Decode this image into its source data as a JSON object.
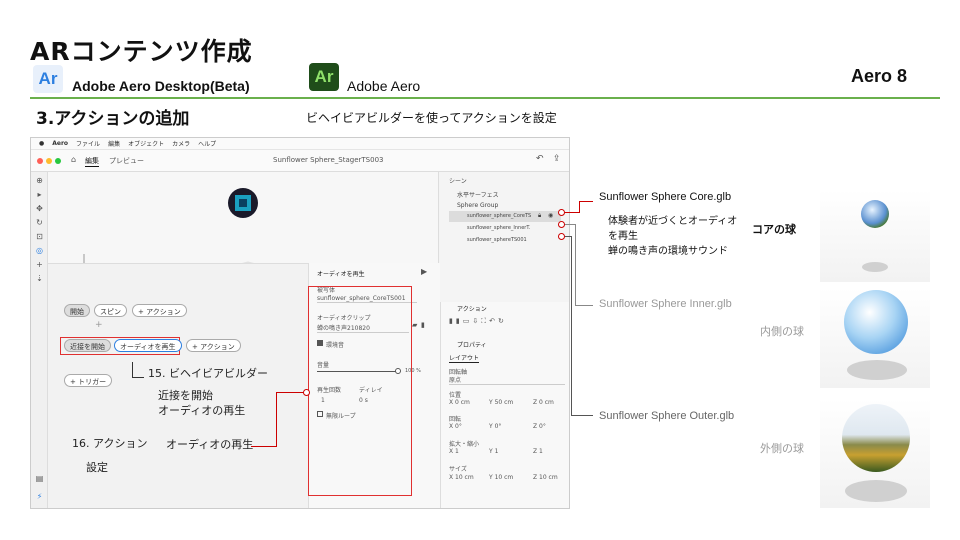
{
  "header": {
    "title": "ARコンテンツ作成",
    "brand1_logo": "Ar",
    "brand1_name": "Adobe Aero Desktop(Beta)",
    "brand2_logo": "Ar",
    "brand2_name": "Adobe Aero",
    "page_label": "Aero 8",
    "section": "3.アクションの追加",
    "section_desc": "ビヘイビアビルダーを使ってアクションを設定",
    "brand1_color": "#2d7fe0",
    "brand2_color": "#1f4d1a",
    "accent_line": "#6ab04c"
  },
  "app": {
    "menu": [
      "",
      "Aero",
      "ファイル",
      "編集",
      "オブジェクト",
      "カメラ",
      "ヘルプ"
    ],
    "tabs": {
      "edit": "編集",
      "preview": "プレビュー"
    },
    "doc_title": "Sunflower Sphere_StagerTS003",
    "scene": {
      "header": "シーン",
      "items": [
        "水平サーフェス",
        "Sphere Group",
        "sunflower_sphere_CoreTS",
        "sunflower_sphere_InnerT.",
        "sunflower_sphereTS001"
      ]
    },
    "behavior": {
      "start": "開始",
      "spin": "スピン",
      "add_action": "+ アクション",
      "plus": "+",
      "proximity": "近接を開始",
      "play_audio": "オーディオを再生",
      "add_action2": "+ アクション",
      "trigger": "+ トリガー"
    },
    "audio": {
      "title": "オーディオを再生",
      "target_label": "被写体",
      "target_value": "sunflower_sphere_CoreTS001",
      "clip_label": "オーディオクリップ",
      "clip_value": "蝉の鳴き声210820",
      "ambient": "環境音",
      "volume_label": "音量",
      "volume_value": "100 %",
      "repeat_label": "再生回数",
      "delay_label": "ディレイ",
      "repeat_value": "1",
      "delay_value": "0 s",
      "loop": "無限ループ"
    },
    "props": {
      "action_header": "アクション",
      "prop_header": "プロパティ",
      "layout": "レイアウト",
      "pivot": "回転軸",
      "pivot_value": "原点",
      "position": "位置",
      "pos_x": "X 0 cm",
      "pos_y": "Y 50 cm",
      "pos_z": "Z 0 cm",
      "rotation": "回転",
      "rot_x": "X 0°",
      "rot_y": "Y 0°",
      "rot_z": "Z 0°",
      "scale": "拡大・縮小",
      "sc_x": "X 1",
      "sc_y": "Y 1",
      "sc_z": "Z 1",
      "size": "サイズ",
      "sz_x": "X 10 cm",
      "sz_y": "Y 10 cm",
      "sz_z": "Z 10 cm"
    }
  },
  "annotations": {
    "builder": "15. ビヘイビアビルダー",
    "builder_desc1": "近接を開始",
    "builder_desc2": "オーディオの再生",
    "action_label": "16. アクション",
    "action_value": "オーディオの再生",
    "action_sub": "設定"
  },
  "right": {
    "core_file": "Sunflower Sphere Core.glb",
    "core_desc1": "体験者が近づくとオーディオ",
    "core_desc2": "を再生",
    "core_desc3": "蝉の鳴き声の環境サウンド",
    "core_label": "コアの球",
    "inner_file": "Sunflower Sphere Inner.glb",
    "inner_label": "内側の球",
    "outer_file": "Sunflower Sphere Outer.glb",
    "outer_label": "外側の球"
  }
}
